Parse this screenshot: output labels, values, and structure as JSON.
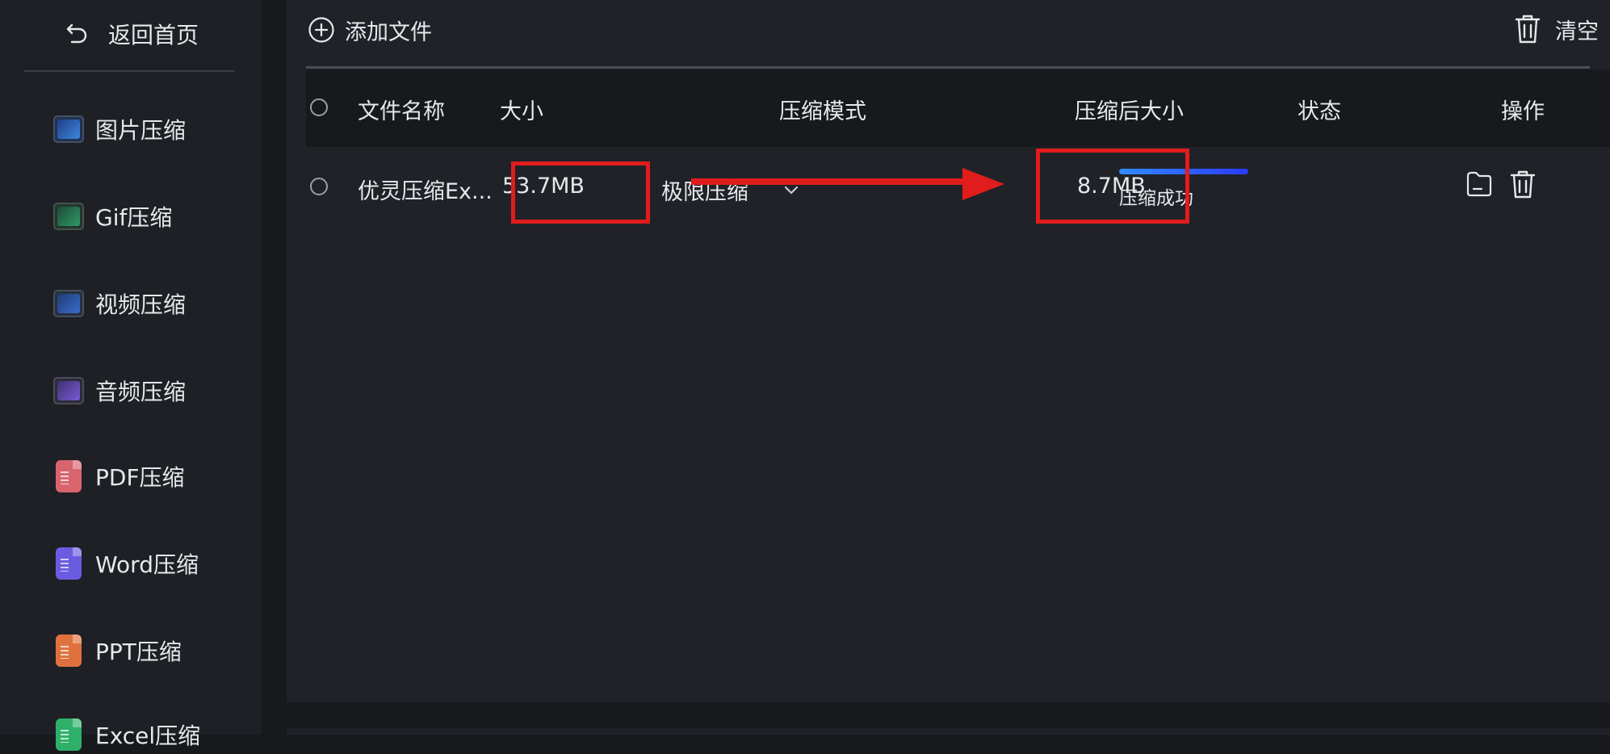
{
  "sidebar": {
    "back_label": "返回首页",
    "items": [
      {
        "label": "图片压缩",
        "icon": "image-icon",
        "color": "#2d6bd6"
      },
      {
        "label": "Gif压缩",
        "icon": "gif-icon",
        "color": "#2f9a6a"
      },
      {
        "label": "视频压缩",
        "icon": "video-icon",
        "color": "#3a6ccf"
      },
      {
        "label": "音频压缩",
        "icon": "audio-icon",
        "color": "#7a5ad6"
      },
      {
        "label": "PDF压缩",
        "icon": "pdf-icon",
        "color": "#d9646e"
      },
      {
        "label": "Word压缩",
        "icon": "word-icon",
        "color": "#6a5be0"
      },
      {
        "label": "PPT压缩",
        "icon": "ppt-icon",
        "color": "#e0713f"
      },
      {
        "label": "Excel压缩",
        "icon": "excel-icon",
        "color": "#2fb06a"
      }
    ]
  },
  "toolbar": {
    "add_label": "添加文件",
    "clear_label": "清空"
  },
  "table": {
    "headers": {
      "name": "文件名称",
      "size": "大小",
      "mode": "压缩模式",
      "compressed_size": "压缩后大小",
      "status": "状态",
      "actions": "操作"
    },
    "rows": [
      {
        "name": "优灵压缩Ex...",
        "size": "53.7MB",
        "mode": "极限压缩",
        "compressed_size": "8.7MB",
        "status": "压缩成功",
        "progress": 1.0
      }
    ]
  },
  "colors": {
    "accent": "#2f8cff",
    "annotation": "#e01c1c"
  }
}
